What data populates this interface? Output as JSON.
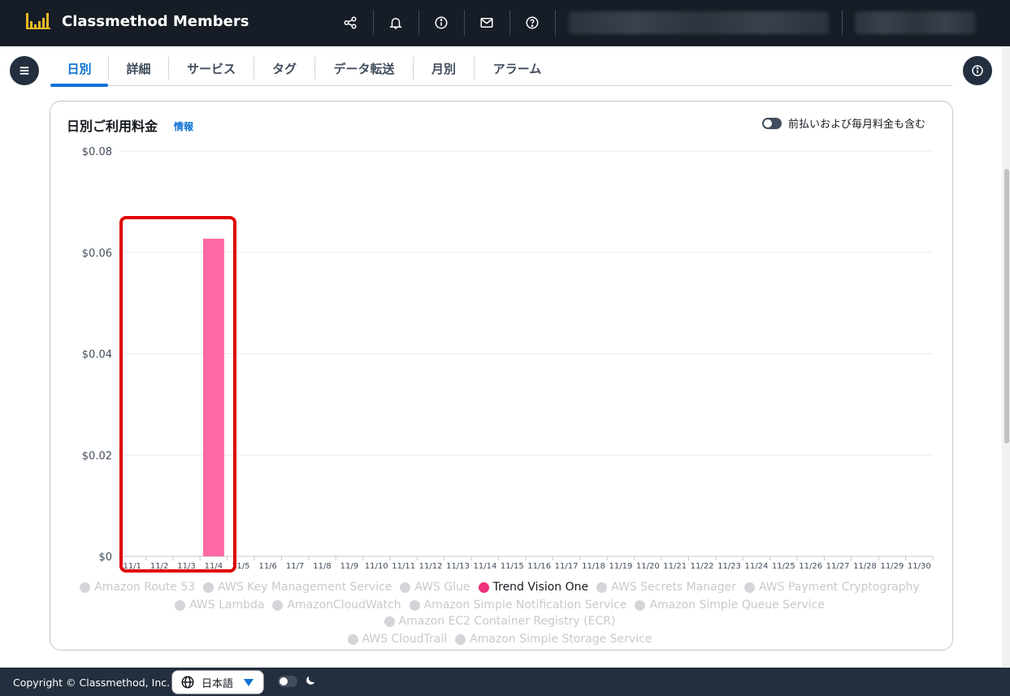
{
  "app": {
    "name": "Classmethod Members"
  },
  "colors": {
    "accent": "#0972d3",
    "bar": "#ff69a5",
    "legend_active": "#f0317c",
    "topbar": "#161d26",
    "highlight": "#e00000"
  },
  "topnav": {
    "icons": [
      "share-icon",
      "bell-icon",
      "info-icon",
      "mail-icon",
      "help-icon"
    ]
  },
  "tabs": [
    {
      "label": "日別",
      "active": true
    },
    {
      "label": "詳細"
    },
    {
      "label": "サービス"
    },
    {
      "label": "タグ"
    },
    {
      "label": "データ転送"
    },
    {
      "label": "月別"
    },
    {
      "label": "アラーム"
    }
  ],
  "card": {
    "title": "日別ご利用料金",
    "info_link": "情報",
    "toggle_label": "前払いおよび毎月料金も含む"
  },
  "chart_data": {
    "type": "bar",
    "categories": [
      "11/1",
      "11/2",
      "11/3",
      "11/4",
      "11/5",
      "11/6",
      "11/7",
      "11/8",
      "11/9",
      "11/10",
      "11/11",
      "11/12",
      "11/13",
      "11/14",
      "11/15",
      "11/16",
      "11/17",
      "11/18",
      "11/19",
      "11/20",
      "11/21",
      "11/22",
      "11/23",
      "11/24",
      "11/25",
      "11/26",
      "11/27",
      "11/28",
      "11/29",
      "11/30"
    ],
    "series": [
      {
        "name": "Trend Vision One",
        "values": [
          0,
          0,
          0,
          0.0627,
          0,
          0,
          0,
          0,
          0,
          0,
          0,
          0,
          0,
          0,
          0,
          0,
          0,
          0,
          0,
          0,
          0,
          0,
          0,
          0,
          0,
          0,
          0,
          0,
          0,
          0
        ]
      }
    ],
    "yticks": [
      "$0",
      "$0.02",
      "$0.04",
      "$0.06",
      "$0.08"
    ],
    "ylim": [
      0,
      0.08
    ],
    "grid": true,
    "legend": "bottom"
  },
  "legend": [
    {
      "label": "Amazon Route 53"
    },
    {
      "label": "AWS Key Management Service"
    },
    {
      "label": "AWS Glue"
    },
    {
      "label": "Trend Vision One",
      "active": true
    },
    {
      "label": "AWS Secrets Manager"
    },
    {
      "label": "AWS Payment Cryptography"
    },
    {
      "label": "AWS Lambda"
    },
    {
      "label": "AmazonCloudWatch"
    },
    {
      "label": "Amazon Simple Notification Service"
    },
    {
      "label": "Amazon Simple Queue Service"
    },
    {
      "label": "Amazon EC2 Container Registry (ECR)"
    },
    {
      "label": "AWS CloudTrail"
    },
    {
      "label": "Amazon Simple Storage Service"
    }
  ],
  "footer": {
    "copyright": "Copyright © Classmethod, Inc.",
    "language": "日本語"
  }
}
